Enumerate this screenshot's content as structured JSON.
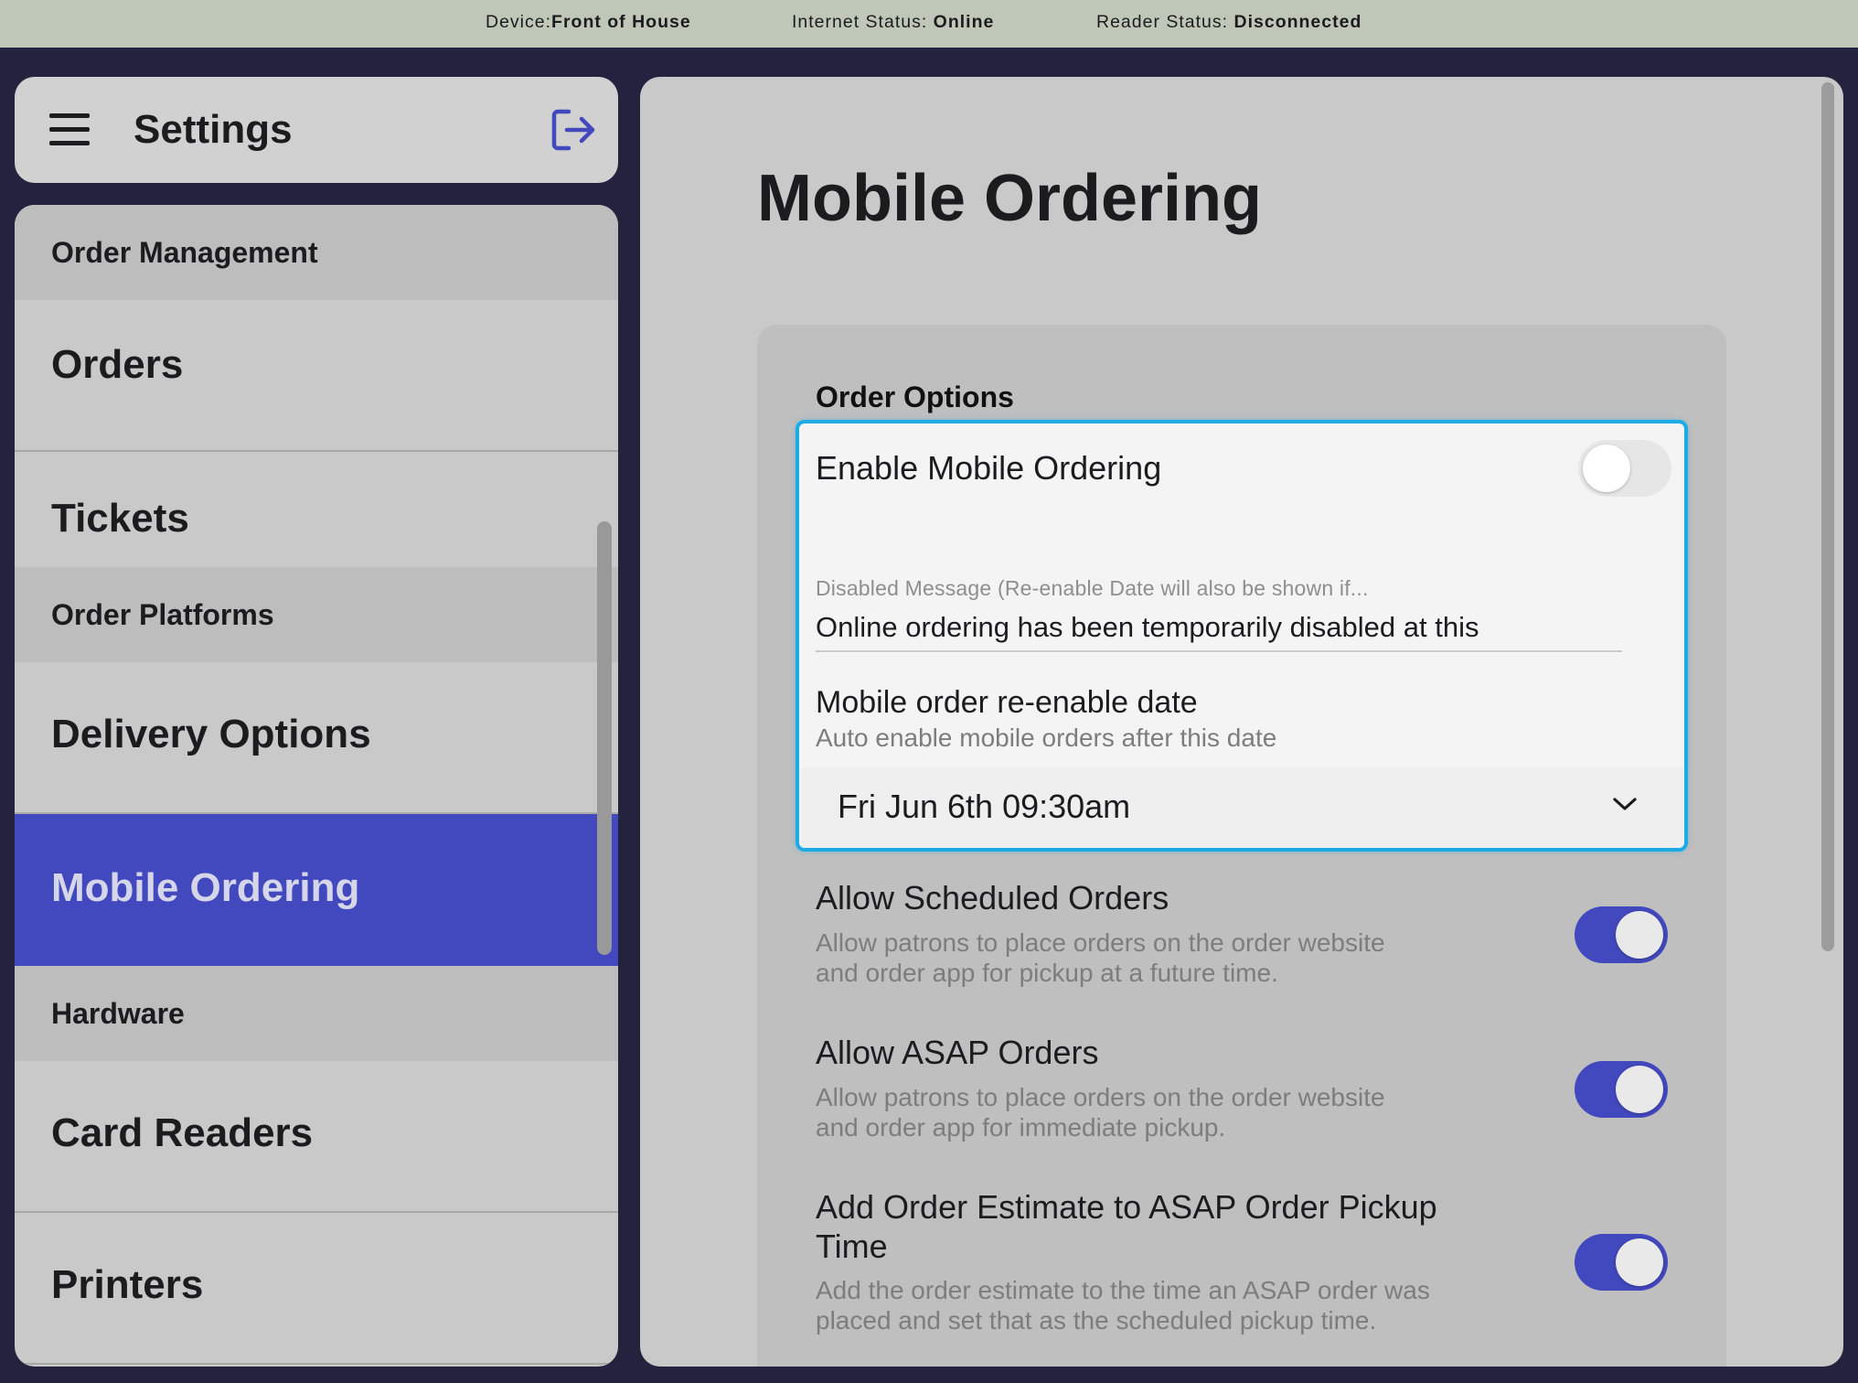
{
  "status_bar": {
    "device_label": "Device:",
    "device_value": "Front of House",
    "internet_label": "Internet Status: ",
    "internet_value": "Online",
    "reader_label": "Reader Status: ",
    "reader_value": "Disconnected"
  },
  "sidebar": {
    "title": "Settings",
    "menu_icon": "hamburger-menu-icon",
    "logout_icon": "logout-arrow-icon",
    "sections": [
      {
        "header": "Order Management",
        "items": [
          "Orders",
          "Tickets"
        ]
      },
      {
        "header": "Order Platforms",
        "items": [
          "Delivery Options",
          "Mobile Ordering"
        ]
      },
      {
        "header": "Hardware",
        "items": [
          "Card Readers",
          "Printers"
        ]
      }
    ],
    "active_item": "Mobile Ordering"
  },
  "main": {
    "title": "Mobile Ordering",
    "card_title": "Order Options",
    "enable_mobile_ordering": {
      "label": "Enable Mobile Ordering",
      "enabled": false
    },
    "disabled_message": {
      "label": "Disabled Message (Re-enable Date will also be shown if...",
      "value": "Online ordering has been temporarily disabled at this"
    },
    "reenable_date": {
      "label": "Mobile order re-enable date",
      "description": "Auto enable mobile orders after this date",
      "value": "Fri Jun 6th 09:30am"
    },
    "options": [
      {
        "label": "Allow Scheduled Orders",
        "description_line1": "Allow patrons to place orders on the order website",
        "description_line2": "and order app for pickup at a future time.",
        "enabled": true
      },
      {
        "label": "Allow ASAP Orders",
        "description_line1": "Allow patrons to place orders on the order website",
        "description_line2": "and order app for immediate pickup.",
        "enabled": true
      },
      {
        "label_line1": "Add Order Estimate to ASAP Order Pickup",
        "label_line2": "Time",
        "description_line1": "Add the order estimate to the time an ASAP order was",
        "description_line2": "placed and set that as the scheduled pickup time.",
        "enabled": true
      }
    ]
  },
  "colors": {
    "accent": "#4248bd",
    "background": "#23233f",
    "status_bar": "#bfc7b8",
    "highlight_border": "#1cabe5"
  }
}
